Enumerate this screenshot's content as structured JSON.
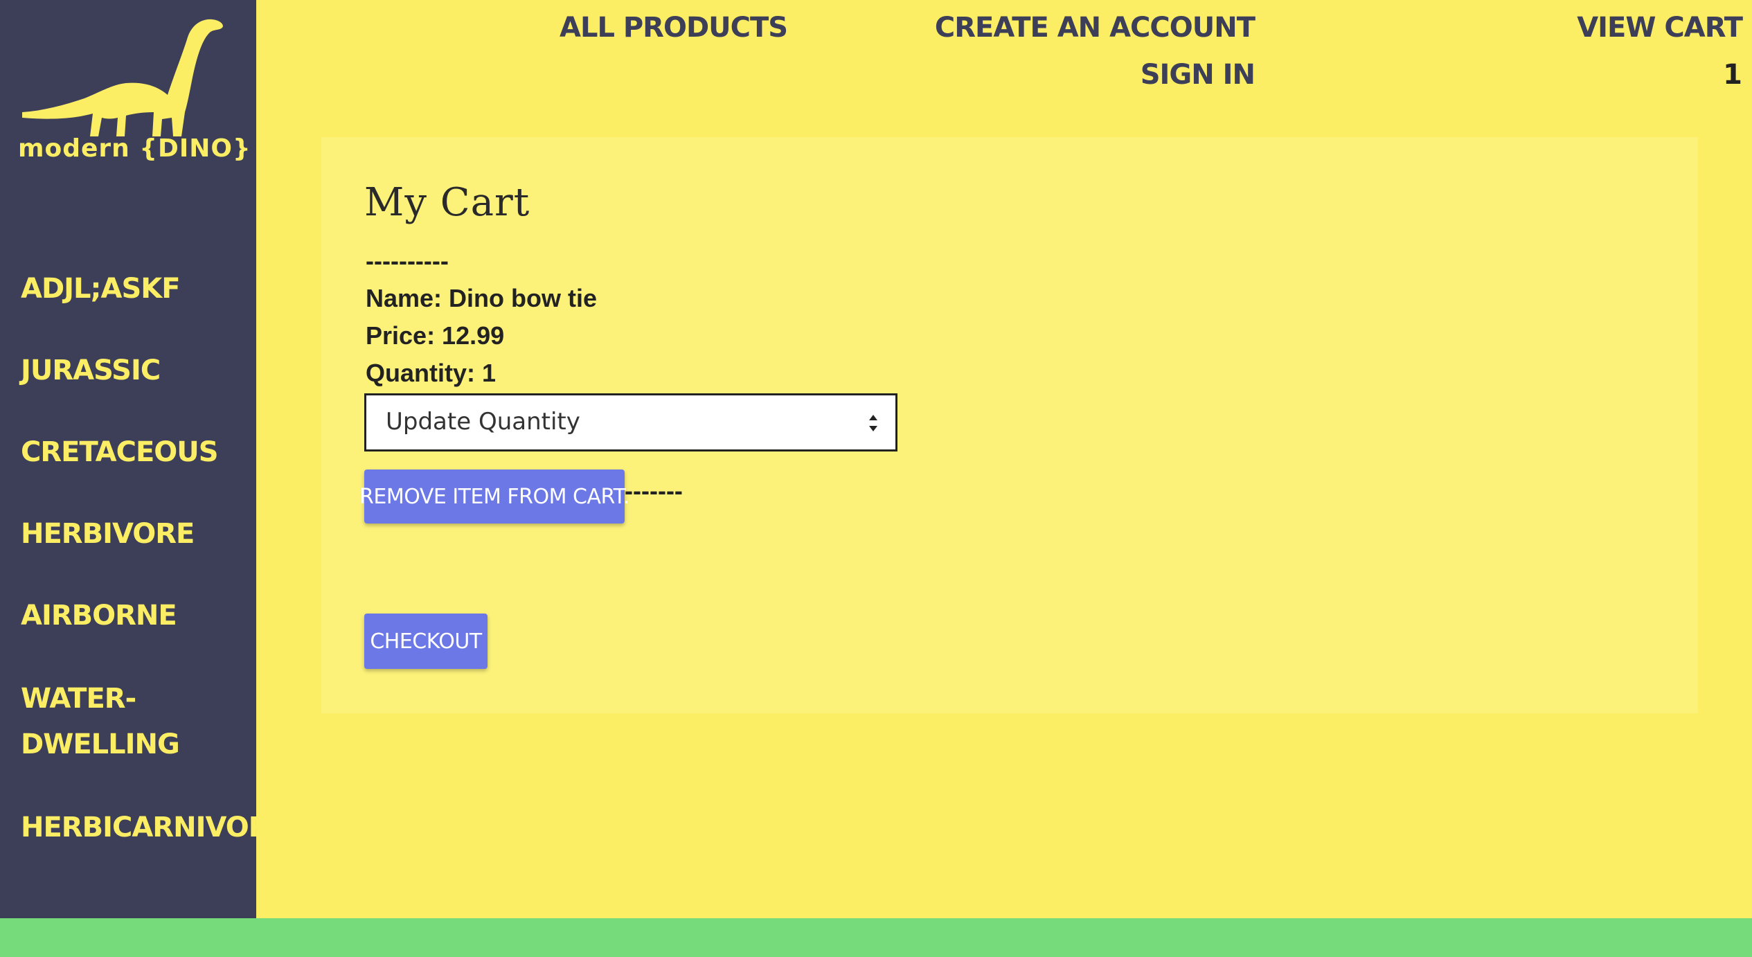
{
  "brand": {
    "logo_text": "modern {DINO}"
  },
  "sidebar": {
    "items": [
      {
        "label": "ADJL;ASKF"
      },
      {
        "label": "JURASSIC"
      },
      {
        "label": "CRETACEOUS"
      },
      {
        "label": "HERBIVORE"
      },
      {
        "label": "AIRBORNE"
      },
      {
        "label": "WATER-DWELLING"
      },
      {
        "label": "HERBICARNIVORE"
      }
    ]
  },
  "header": {
    "all_products": "ALL PRODUCTS",
    "create_account": "CREATE AN ACCOUNT",
    "sign_in": "SIGN IN",
    "view_cart": "VIEW CART",
    "cart_count": "1"
  },
  "cart": {
    "title": "My Cart",
    "separator": "----------",
    "item": {
      "name_line": "Name: Dino bow tie",
      "price_line": "Price: 12.99",
      "quantity_line": "Quantity: 1"
    },
    "quantity_select": {
      "selected": "Update Quantity"
    },
    "remove_button": "REMOVE ITEM FROM CART.",
    "trailing_separator": "-------",
    "checkout_button": "CHECKOUT"
  },
  "colors": {
    "background": "#fcee64",
    "sidebar": "#3c3f57",
    "panel": "#fcf27a",
    "button": "#6b78e5",
    "footer": "#76db7a"
  }
}
